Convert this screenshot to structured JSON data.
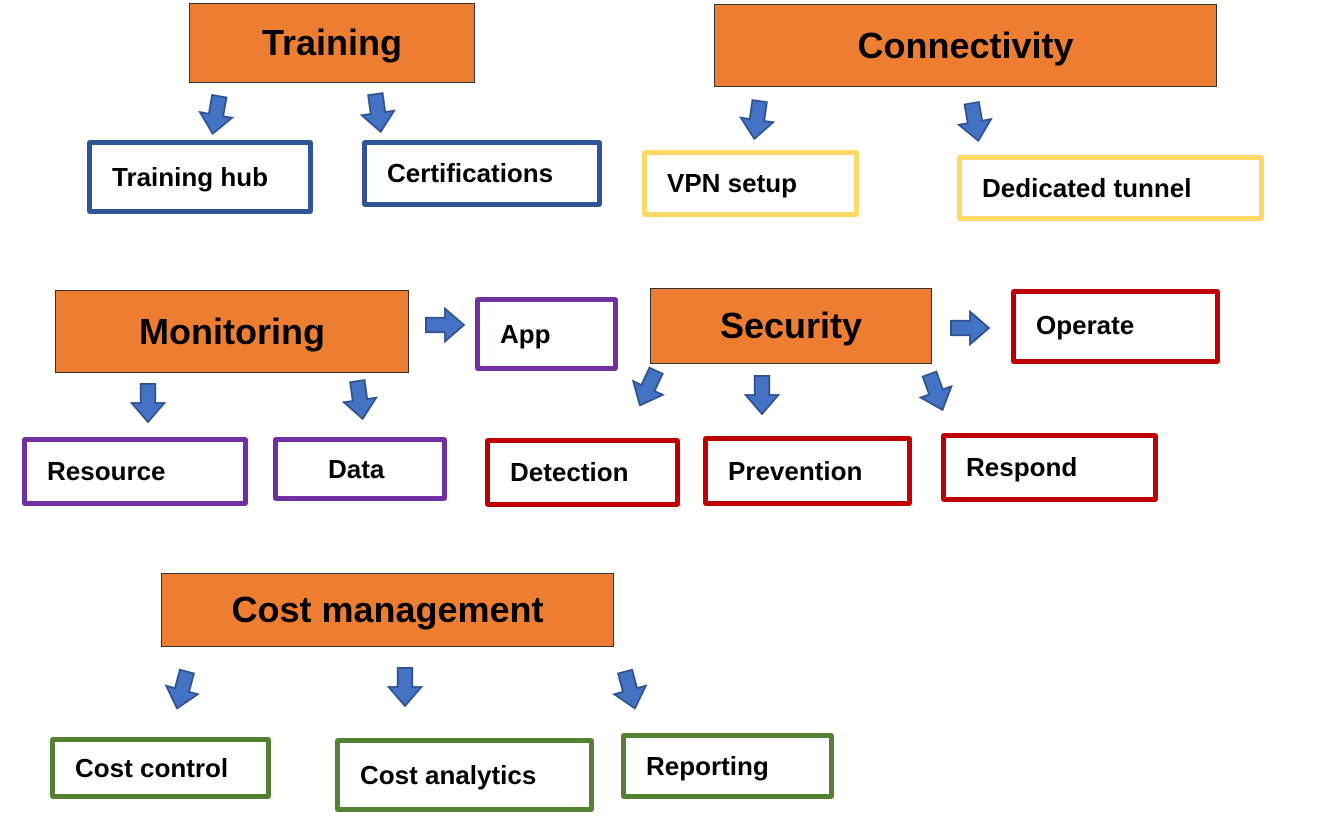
{
  "colors": {
    "header_fill": "#ED7D31",
    "arrow_fill": "#4472C4",
    "arrow_stroke": "#2F528F",
    "training": "#2F5597",
    "connectivity": "#FFD966",
    "monitoring": "#7030A0",
    "security": "#C00000",
    "cost": "#548235"
  },
  "training": {
    "title": "Training",
    "items": [
      "Training hub",
      "Certifications"
    ]
  },
  "connectivity": {
    "title": "Connectivity",
    "items": [
      "VPN setup",
      "Dedicated tunnel"
    ]
  },
  "monitoring": {
    "title": "Monitoring",
    "items": [
      "App",
      "Resource",
      "Data"
    ]
  },
  "security": {
    "title": "Security",
    "items": [
      "Operate",
      "Detection",
      "Prevention",
      "Respond"
    ]
  },
  "cost": {
    "title": "Cost management",
    "items": [
      "Cost control",
      "Cost analytics",
      "Reporting"
    ]
  }
}
